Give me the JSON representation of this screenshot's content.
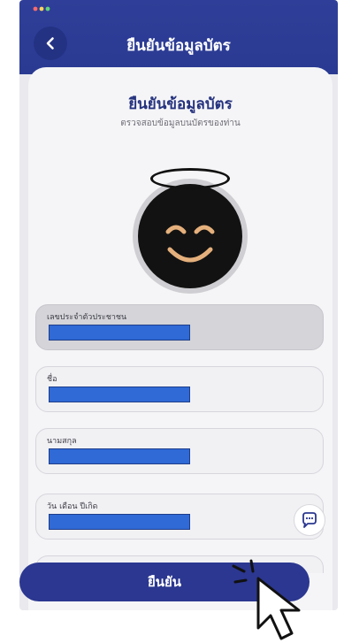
{
  "header": {
    "title": "ยืนยันข้อมูลบัตร",
    "back_icon": "chevron-left-icon"
  },
  "card": {
    "title": "ยืนยันข้อมูลบัตร",
    "subtitle": "ตรวจสอบข้อมูลบนบัตรของท่าน"
  },
  "fields": [
    {
      "label": "เลขประจำตัวประชาชน",
      "readonly": true
    },
    {
      "label": "ชื่อ",
      "readonly": false
    },
    {
      "label": "นามสกุล",
      "readonly": false
    },
    {
      "label": "วัน เดือน ปีเกิด",
      "readonly": false
    }
  ],
  "chat_icon": "chat-bubble-icon",
  "confirm_button": {
    "label": "ยืนยัน"
  },
  "colors": {
    "primary": "#2b3790",
    "redaction": "#2f6ad6",
    "avatar_line": "#e5b07c"
  }
}
